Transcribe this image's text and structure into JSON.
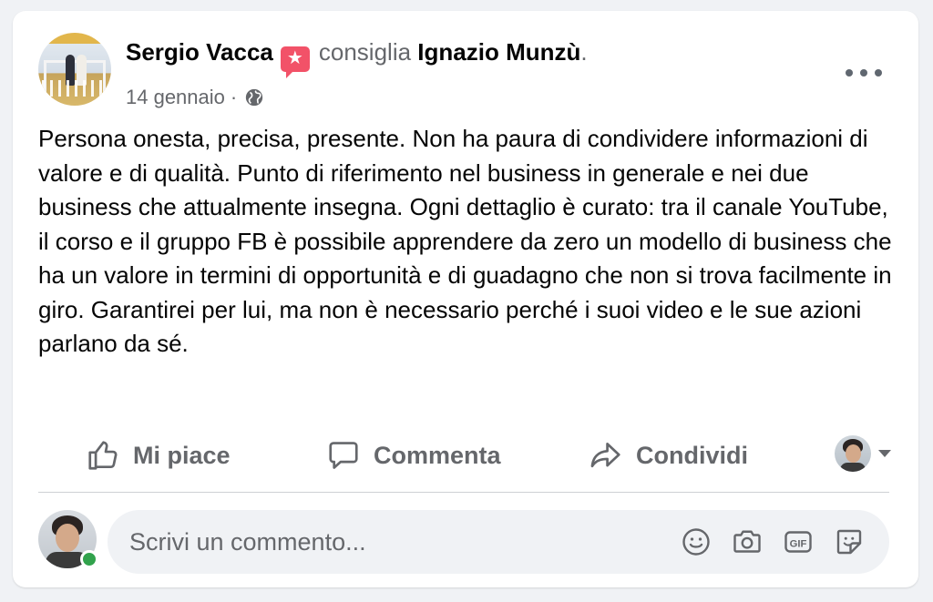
{
  "post": {
    "author": "Sergio Vacca",
    "badge_icon": "recommendation-star-icon",
    "verb": "consiglia",
    "target": "Ignazio Munzù",
    "target_suffix": ".",
    "date": "14 gennaio",
    "separator": "·",
    "privacy_icon": "globe-icon",
    "text": "Persona onesta, precisa, presente. Non ha paura di condividere informazioni di valore e di qualità. Punto di riferimento nel business in generale e nei due business che attualmente insegna. Ogni dettaglio è curato: tra il canale YouTube, il corso e il gruppo FB è possibile apprendere da zero un modello di business che ha un valore in termini di opportunità e di guadagno che non si trova facilmente in giro. Garantirei per lui, ma non è necessario perché i suoi video e le sue azioni parlano da sé."
  },
  "actions": {
    "like_label": "Mi piace",
    "comment_label": "Commenta",
    "share_label": "Condividi"
  },
  "comment_box": {
    "placeholder": "Scrivi un commento..."
  },
  "colors": {
    "badge": "#f25268",
    "online": "#31a24c",
    "muted_text": "#65676b",
    "input_bg": "#f0f2f5"
  }
}
